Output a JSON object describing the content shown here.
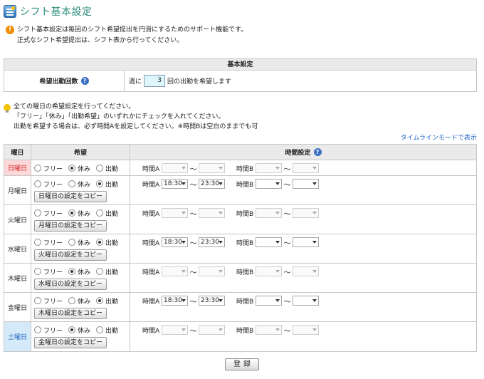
{
  "page": {
    "title": "シフト基本設定"
  },
  "notice": {
    "line1": "シフト基本設定は毎回のシフト希望提出を円滑にするためのサポート機能です。",
    "line2": "正式なシフト希望提出は、シフト表から行ってください。"
  },
  "basic": {
    "header": "基本設定",
    "label": "希望出勤回数",
    "prefix": "週に",
    "value": "3",
    "suffix": "回の出勤を希望します"
  },
  "hints": {
    "line1": "全ての曜日の希望設定を行ってください。",
    "line2": "「フリー」「休み」「出勤希望」のいずれかにチェックを入れてください。",
    "line3": "出勤を希望する場合は、必ず時間Aを設定してください。※時間Bは空白のままでも可"
  },
  "timeline_link": "タイムラインモードで表示",
  "table": {
    "col_day": "曜日",
    "col_wish": "希望",
    "col_time": "時間設定"
  },
  "options": {
    "free": "フリー",
    "off": "休み",
    "work": "出勤"
  },
  "time_labels": {
    "a": "時間A",
    "b": "時間B",
    "tilde": "〜"
  },
  "days": [
    {
      "name": "日曜日",
      "choice": "off",
      "copy": "",
      "a_from": "",
      "a_to": ""
    },
    {
      "name": "月曜日",
      "choice": "work",
      "copy": "日曜日の設定をコピー",
      "a_from": "18:30",
      "a_to": "23:30"
    },
    {
      "name": "火曜日",
      "choice": "off",
      "copy": "月曜日の設定をコピー",
      "a_from": "",
      "a_to": ""
    },
    {
      "name": "水曜日",
      "choice": "work",
      "copy": "火曜日の設定をコピー",
      "a_from": "18:30",
      "a_to": "23:30"
    },
    {
      "name": "木曜日",
      "choice": "off",
      "copy": "水曜日の設定をコピー",
      "a_from": "",
      "a_to": ""
    },
    {
      "name": "金曜日",
      "choice": "work",
      "copy": "木曜日の設定をコピー",
      "a_from": "18:30",
      "a_to": "23:30"
    },
    {
      "name": "土曜日",
      "choice": "off",
      "copy": "金曜日の設定をコピー",
      "a_from": "",
      "a_to": ""
    }
  ],
  "register_label": "登録"
}
